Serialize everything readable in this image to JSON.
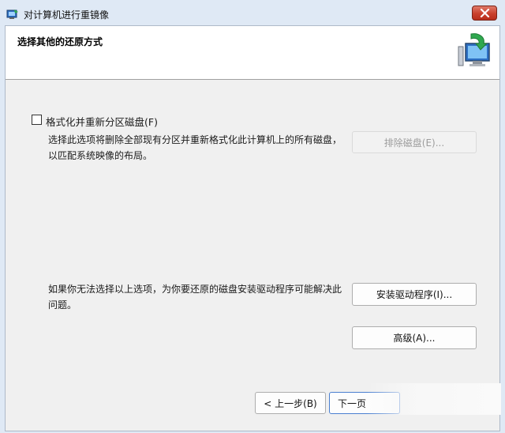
{
  "window": {
    "title": "对计算机进行重镜像",
    "close_icon": "close-icon",
    "app_icon": "restore-app-icon"
  },
  "header": {
    "title": "选择其他的还原方式",
    "icon": "computer-restore-icon"
  },
  "format_option": {
    "checkbox_label": "格式化并重新分区磁盘(F)",
    "checked": false,
    "description": "选择此选项将删除全部现有分区并重新格式化此计算机上的所有磁盘，以匹配系统映像的布局。",
    "exclude_disks_label": "排除磁盘(E)..."
  },
  "driver_section": {
    "description": "如果你无法选择以上选项，为你要还原的磁盘安装驱动程序可能解决此问题。",
    "install_driver_label": "安装驱动程序(I)...",
    "advanced_label": "高级(A)..."
  },
  "footer": {
    "back_label": "< 上一步(B)",
    "next_label": "下一页"
  },
  "colors": {
    "frame": "#dfe9f5",
    "content_bg": "#f0f0f0",
    "close_red": "#c9402c"
  }
}
